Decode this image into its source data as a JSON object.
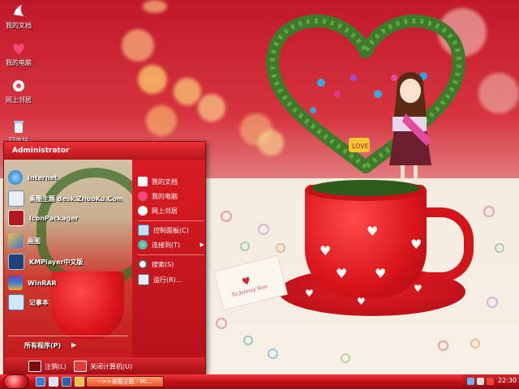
{
  "desktop": {
    "icons": [
      {
        "label": "我的文档",
        "icon": "my-documents-icon"
      },
      {
        "label": "我的电脑",
        "icon": "my-computer-icon"
      },
      {
        "label": "网上邻居",
        "icon": "network-places-icon"
      },
      {
        "label": "回收站",
        "icon": "recycle-bin-icon"
      }
    ],
    "wallpaper": {
      "card_text": "To Johnny Year",
      "sign_text": "LOVE"
    }
  },
  "start_menu": {
    "user": "Administrator",
    "programs": [
      {
        "label": "Internet",
        "icon": "ie-icon"
      },
      {
        "label": "桌酷主题 desk.ZhuoKu.Com",
        "icon": "zhuoku-icon"
      },
      {
        "label": "IconPackager",
        "icon": "iconpackager-icon"
      },
      {
        "label": "画图",
        "icon": "paint-icon"
      },
      {
        "label": "KMPlayer中文版",
        "icon": "kmplayer-icon"
      },
      {
        "label": "WinRAR",
        "icon": "winrar-icon"
      },
      {
        "label": "记事本",
        "icon": "notepad-icon"
      }
    ],
    "all_programs": "所有程序(P)",
    "places": [
      {
        "label": "我的文档",
        "icon": "my-documents-icon"
      },
      {
        "label": "我的电脑",
        "icon": "my-computer-icon"
      },
      {
        "label": "网上邻居",
        "icon": "network-places-icon"
      },
      {
        "label": "控制面板(C)",
        "icon": "control-panel-icon"
      },
      {
        "label": "连接到(T)",
        "icon": "connect-to-icon"
      },
      {
        "label": "搜索(S)",
        "icon": "search-icon"
      },
      {
        "label": "运行(R)...",
        "icon": "run-icon"
      }
    ],
    "logoff": "注销(L)",
    "shutdown": "关闭计算机(U)"
  },
  "taskbar": {
    "task_label": "-->>桌酷主题 - Mi...",
    "clock": "22:30"
  },
  "colors": {
    "theme_red": "#c7141b",
    "accent_dark": "#8e080d"
  }
}
